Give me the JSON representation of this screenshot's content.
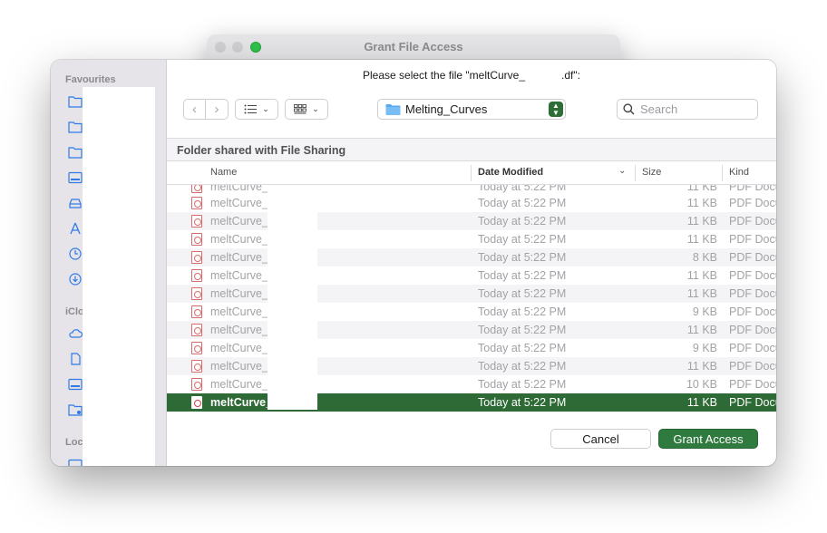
{
  "back_window": {
    "title": "Grant File Access"
  },
  "sidebar": {
    "favourites_header": "Favourites",
    "icloud_header": "iClo",
    "locations_header": "Loc",
    "icons": [
      "folder-icon",
      "folder-icon",
      "folder-icon",
      "desktop-icon",
      "drive-icon",
      "applications-icon",
      "recents-icon",
      "downloads-icon",
      "cloud-icon",
      "document-icon",
      "desktop-icon",
      "shared-folder-icon",
      "computer-icon"
    ]
  },
  "prompt": "Please select the file \"meltCurve_            .df\":",
  "toolbar": {
    "folder_name": "Melting_Curves",
    "search_placeholder": "Search"
  },
  "location_label": "Folder shared with File Sharing",
  "columns": {
    "name": "Name",
    "date": "Date Modified",
    "size": "Size",
    "kind": "Kind"
  },
  "files": [
    {
      "name": "meltCurve_",
      "date": "Today at 5:22 PM",
      "size": "11 KB",
      "kind": "PDF Docu"
    },
    {
      "name": "meltCurve_                      .pdf",
      "date": "Today at 5:22 PM",
      "size": "11 KB",
      "kind": "PDF Docu"
    },
    {
      "name": "meltCurve_                      pdf",
      "date": "Today at 5:22 PM",
      "size": "11 KB",
      "kind": "PDF Docu"
    },
    {
      "name": "meltCurve_                      pdf",
      "date": "Today at 5:22 PM",
      "size": "11 KB",
      "kind": "PDF Docu"
    },
    {
      "name": "meltCurve_                      .pdf",
      "date": "Today at 5:22 PM",
      "size": "8 KB",
      "kind": "PDF Docu"
    },
    {
      "name": "meltCurve_                      .pdf",
      "date": "Today at 5:22 PM",
      "size": "11 KB",
      "kind": "PDF Docu"
    },
    {
      "name": "meltCurve_                      pdf",
      "date": "Today at 5:22 PM",
      "size": "11 KB",
      "kind": "PDF Docu"
    },
    {
      "name": "meltCurve_                      df",
      "date": "Today at 5:22 PM",
      "size": "9 KB",
      "kind": "PDF Docu"
    },
    {
      "name": "meltCurve_                      pdf",
      "date": "Today at 5:22 PM",
      "size": "11 KB",
      "kind": "PDF Docu"
    },
    {
      "name": "meltCurve_                      pdf",
      "date": "Today at 5:22 PM",
      "size": "9 KB",
      "kind": "PDF Docu"
    },
    {
      "name": "meltCurve_                      pdf",
      "date": "Today at 5:22 PM",
      "size": "11 KB",
      "kind": "PDF Docu"
    },
    {
      "name": "meltCurve_                      pdf",
      "date": "Today at 5:22 PM",
      "size": "10 KB",
      "kind": "PDF Docu"
    },
    {
      "name": "meltCurve_                      pdf",
      "date": "Today at 5:22 PM",
      "size": "11 KB",
      "kind": "PDF Docu",
      "selected": true
    }
  ],
  "buttons": {
    "cancel": "Cancel",
    "grant": "Grant Access"
  },
  "colors": {
    "accent": "#2f7a3e",
    "selection": "#2d6a35",
    "folder": "#5aa8f0",
    "pdf": "#d86b6b"
  }
}
